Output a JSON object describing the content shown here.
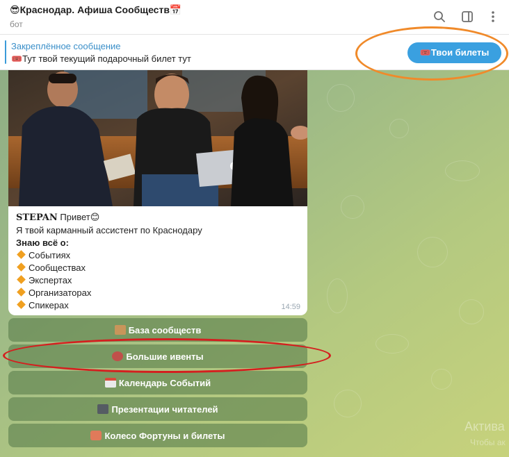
{
  "header": {
    "title": "😎Краснодар. Афиша Сообществ📅",
    "subtitle": "бот"
  },
  "pinned": {
    "title": "Закреплённое сообщение",
    "text": "🎟️Тут твой текущий подарочный билет тут",
    "button_label": "🎟️Твои билеты"
  },
  "message": {
    "sender": "STEPAN",
    "greeting": " Привет😊",
    "intro": "Я твой карманный ассистент по Краснодару",
    "know_heading": "Знаю всё о:",
    "features": [
      "Событиях",
      "Сообществах",
      "Экспертах",
      "Организаторах",
      "Спикерах"
    ],
    "time": "14:59"
  },
  "keyboard": [
    {
      "label": "База сообществ",
      "icon": "database-icon"
    },
    {
      "label": "Большие ивенты",
      "icon": "stadium-icon"
    },
    {
      "label": "Календарь Событий",
      "icon": "calendar-icon"
    },
    {
      "label": "Презентации читателей",
      "icon": "camera-icon"
    },
    {
      "label": "Колесо Фортуны и билеты",
      "icon": "confetti-icon"
    }
  ],
  "watermark": {
    "line1": "Актива",
    "line2": "Чтобы ак"
  },
  "colors": {
    "accent": "#3aa0e0",
    "highlight_orange": "#f08a2a",
    "highlight_red": "#d41f1f"
  }
}
